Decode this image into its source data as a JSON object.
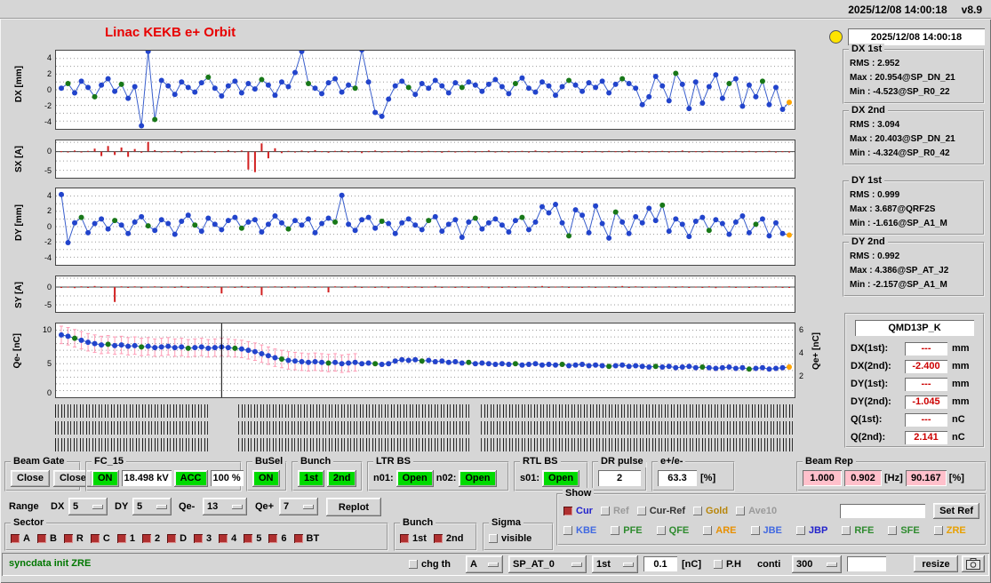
{
  "titlebar": {
    "datetime": "2025/12/08 14:00:18",
    "version": "v8.9"
  },
  "title": "Linac KEKB e+ Orbit",
  "colors": {
    "title": "#e80000",
    "green": "#00db00",
    "pink": "#ffc0cb",
    "value_red": "#cc0000",
    "message_green": "#007700",
    "lamp": "#ffe400"
  },
  "status": {
    "timestamp": "2025/12/08 14:00:18",
    "groups": [
      {
        "label": "DX 1st",
        "lines": [
          "RMS : 2.952",
          "Max : 20.954@SP_DN_21",
          "Min : -4.523@SP_R0_22"
        ]
      },
      {
        "label": "DX 2nd",
        "lines": [
          "RMS : 3.094",
          "Max : 20.403@SP_DN_21",
          "Min : -4.324@SP_R0_42"
        ]
      },
      {
        "label": "DY 1st",
        "lines": [
          "RMS : 0.999",
          "Max : 3.687@QRF2S",
          "Min : -1.616@SP_A1_M"
        ]
      },
      {
        "label": "DY 2nd",
        "lines": [
          "RMS : 0.992",
          "Max : 4.386@SP_AT_J2",
          "Min : -2.157@SP_A1_M"
        ]
      }
    ],
    "monitor": {
      "name": "QMD13P_K",
      "rows": [
        {
          "label": "DX(1st):",
          "value": "---",
          "unit": "mm"
        },
        {
          "label": "DX(2nd):",
          "value": "-2.400",
          "unit": "mm"
        },
        {
          "label": "DY(1st):",
          "value": "---",
          "unit": "mm"
        },
        {
          "label": "DY(2nd):",
          "value": "-1.045",
          "unit": "mm"
        },
        {
          "label": "Q(1st):",
          "value": "---",
          "unit": "nC"
        },
        {
          "label": "Q(2nd):",
          "value": "2.141",
          "unit": "nC"
        }
      ]
    }
  },
  "chart_data": [
    {
      "id": "dx",
      "type": "line",
      "ylabel": "DX [mm]",
      "ylim": [
        -5,
        5
      ],
      "yticks": [
        4,
        2,
        0,
        -2,
        -4
      ],
      "grid": [
        -4,
        -3,
        -2,
        -1,
        0,
        1,
        2,
        3,
        4
      ],
      "line_color": "#3a5fcd",
      "point_color": "#2244cc",
      "alt_color": "#187818",
      "last_color": "#ffa500",
      "green_indices": [
        1,
        5,
        9,
        14,
        22,
        30,
        37,
        44,
        52,
        60,
        68,
        76,
        84,
        92,
        100,
        105
      ],
      "values": [
        0.2,
        0.8,
        -0.4,
        1.1,
        0.3,
        -0.9,
        0.6,
        1.4,
        -0.2,
        0.7,
        -1.1,
        0.4,
        -4.6,
        4.9,
        -3.8,
        1.2,
        0.5,
        -0.6,
        1.0,
        0.3,
        -0.3,
        0.9,
        1.6,
        0.2,
        -0.8,
        0.5,
        1.1,
        -0.4,
        0.8,
        0.1,
        1.3,
        0.6,
        -0.7,
        1.0,
        0.4,
        2.2,
        4.9,
        0.8,
        0.2,
        -0.5,
        0.9,
        1.4,
        -0.3,
        0.6,
        0.2,
        5.1,
        1.0,
        -2.9,
        -3.4,
        -1.2,
        0.5,
        1.1,
        0.3,
        -0.6,
        0.8,
        0.2,
        1.2,
        0.5,
        -0.4,
        0.9,
        0.3,
        1.0,
        0.6,
        -0.2,
        0.7,
        1.3,
        0.4,
        -0.5,
        0.8,
        1.5,
        0.2,
        -0.3,
        1.0,
        0.5,
        -0.7,
        0.4,
        1.2,
        0.6,
        -0.2,
        0.9,
        0.3,
        1.1,
        -0.4,
        0.7,
        1.4,
        0.8,
        0.2,
        -1.9,
        -0.9,
        1.7,
        0.5,
        -1.4,
        2.1,
        0.7,
        -2.4,
        1.0,
        -1.7,
        0.4,
        1.9,
        -1.1,
        0.8,
        1.4,
        -2.1,
        0.6,
        -0.9,
        1.1,
        -1.9,
        0.3,
        -2.5,
        -1.6
      ]
    },
    {
      "id": "sx",
      "type": "bar",
      "ylabel": "SX [A]",
      "ylim": [
        -7,
        3
      ],
      "yticks": [
        0,
        -5
      ],
      "grid": [
        -5,
        -2.5,
        0,
        2.5
      ],
      "color": "#d22020",
      "values": [
        0.1,
        -0.2,
        0.3,
        -0.1,
        0.2,
        0.8,
        -1.2,
        1.5,
        -0.9,
        1.1,
        -1.4,
        0.7,
        -0.3,
        2.6,
        0.4,
        -0.2,
        0.1,
        0.3,
        -0.4,
        0.2,
        -0.1,
        0.3,
        0.2,
        -0.3,
        0.1,
        0.4,
        -0.2,
        0.3,
        -4.8,
        -5.5,
        2.2,
        -1.8,
        0.9,
        -0.4,
        0.2,
        -0.1,
        0.3,
        -0.2,
        0.4,
        0.1,
        -0.3,
        0.2,
        0.3,
        -0.1,
        0.2,
        -0.4,
        0.1,
        0.3,
        -0.2,
        0.1,
        0.2,
        -0.1,
        0.3,
        0.1,
        -0.2,
        0.2,
        0.1,
        -0.3,
        0.2,
        -0.1,
        0.1,
        0.2,
        -0.2,
        0.1,
        0.3,
        -0.1,
        0.2,
        -0.2,
        0.1,
        0.2,
        -0.1,
        0.3,
        0.1,
        -0.2,
        0.2,
        -0.1,
        0.1,
        0.2,
        -0.3,
        0.1,
        0.2,
        -0.1,
        0.2,
        0.1,
        -0.2,
        0.3,
        -0.1,
        0.2,
        -0.2,
        0.1,
        0.2,
        -0.1,
        0.1,
        0.3,
        -0.2,
        0.1,
        -0.1,
        0.2,
        0.1,
        -0.2,
        0.1,
        0.2,
        -0.1,
        0.2,
        -0.2,
        0.1,
        0.2,
        -0.1,
        0.1,
        -0.2
      ]
    },
    {
      "id": "dy",
      "type": "line",
      "ylabel": "DY [mm]",
      "ylim": [
        -5,
        5
      ],
      "yticks": [
        4,
        2,
        0,
        -2,
        -4
      ],
      "grid": [
        -4,
        -3,
        -2,
        -1,
        0,
        1,
        2,
        3,
        4
      ],
      "line_color": "#3a5fcd",
      "point_color": "#2244cc",
      "alt_color": "#187818",
      "last_color": "#ffa500",
      "green_indices": [
        3,
        8,
        13,
        20,
        27,
        34,
        41,
        48,
        55,
        62,
        69,
        76,
        83,
        90,
        97,
        104
      ],
      "values": [
        4.2,
        -2.1,
        0.5,
        1.2,
        -0.8,
        0.4,
        1.0,
        -0.3,
        0.8,
        0.2,
        -0.9,
        0.6,
        1.3,
        0.1,
        -0.5,
        0.9,
        0.4,
        -1.0,
        0.7,
        1.5,
        0.2,
        -0.6,
        1.1,
        0.3,
        -0.4,
        0.8,
        1.2,
        -0.2,
        0.6,
        0.9,
        -0.7,
        0.3,
        1.4,
        0.5,
        -0.3,
        0.8,
        0.2,
        1.0,
        -0.8,
        0.4,
        1.1,
        0.6,
        4.1,
        0.3,
        -0.5,
        0.9,
        1.2,
        -0.2,
        0.7,
        0.4,
        -0.9,
        0.5,
        1.0,
        0.2,
        -0.4,
        0.8,
        1.3,
        -0.6,
        0.3,
        0.9,
        -1.4,
        0.6,
        1.1,
        -0.3,
        0.5,
        1.0,
        0.2,
        -0.7,
        0.8,
        1.2,
        -0.4,
        0.6,
        2.6,
        1.8,
        2.9,
        0.5,
        -1.2,
        2.2,
        1.5,
        -0.8,
        2.7,
        0.4,
        -1.5,
        1.9,
        0.6,
        -0.9,
        1.3,
        0.5,
        2.4,
        0.8,
        2.8,
        -0.6,
        1.0,
        0.3,
        -1.3,
        0.7,
        1.2,
        -0.5,
        0.9,
        0.4,
        -1.0,
        0.6,
        1.4,
        -0.8,
        0.3,
        1.0,
        -1.2,
        0.5,
        -0.9,
        -1.1
      ]
    },
    {
      "id": "sy",
      "type": "bar",
      "ylabel": "SY [A]",
      "ylim": [
        -7,
        3
      ],
      "yticks": [
        0,
        -5
      ],
      "grid": [
        -5,
        -2.5,
        0,
        2.5
      ],
      "color": "#d22020",
      "values": [
        -0.2,
        0.1,
        -0.3,
        0.2,
        -0.1,
        0.3,
        -0.2,
        0.1,
        -4.2,
        0.2,
        -0.1,
        0.2,
        -0.3,
        0.1,
        0.2,
        -0.2,
        0.1,
        -0.1,
        0.3,
        -0.2,
        0.1,
        0.2,
        -0.1,
        0.2,
        -1.8,
        0.1,
        -0.2,
        0.3,
        -0.1,
        0.2,
        -2.3,
        0.1,
        0.2,
        -0.1,
        0.2,
        -0.3,
        0.1,
        0.2,
        -0.2,
        0.1,
        -1.5,
        0.2,
        -0.1,
        0.1,
        0.3,
        -0.2,
        0.1,
        -0.1,
        0.2,
        -0.3,
        0.1,
        0.2,
        -0.1,
        0.2,
        -0.2,
        0.1,
        0.3,
        -0.1,
        0.1,
        -0.2,
        0.2,
        -0.1,
        0.1,
        0.2,
        -0.3,
        0.1,
        -0.1,
        0.2,
        -0.2,
        0.1,
        0.2,
        -0.1,
        0.3,
        -0.2,
        0.1,
        0.2,
        -0.1,
        0.1,
        -0.2,
        0.2,
        -0.1,
        0.1,
        0.2,
        -0.2,
        0.3,
        -0.1,
        0.2,
        -0.1,
        0.1,
        -0.2,
        0.1,
        0.2,
        -0.1,
        0.2,
        -0.2,
        0.1,
        -0.1,
        0.2,
        -0.3,
        0.1,
        0.2,
        -0.1,
        0.1,
        -0.2,
        0.2,
        -0.1,
        0.1,
        0.2,
        -0.1,
        -0.2
      ]
    },
    {
      "id": "q",
      "type": "line",
      "ylabel": "Qe- [nC]",
      "ylabel_right": "Qe+ [nC]",
      "ylim": [
        0,
        11
      ],
      "yticks": [
        10,
        5,
        0
      ],
      "yticks_right": [
        6,
        4,
        2
      ],
      "grid": [
        1,
        2,
        3,
        4,
        5,
        6,
        7,
        8,
        9,
        10
      ],
      "line_color": "#3a5fcd",
      "point_color": "#2244cc",
      "alt_color": "#187818",
      "last_color": "#ffa500",
      "green_indices": [
        2,
        7,
        12,
        19,
        26,
        33,
        40,
        47,
        54,
        61,
        68,
        75,
        82,
        89,
        96,
        103
      ],
      "sigma": {
        "split": 45,
        "early": 1.3,
        "late": 0.3
      },
      "sigma_color": "#ff9bb5",
      "cursor_index": 24,
      "values": [
        9.3,
        9.1,
        8.8,
        8.5,
        8.2,
        8.0,
        7.8,
        7.9,
        7.7,
        7.8,
        7.6,
        7.7,
        7.5,
        7.6,
        7.4,
        7.5,
        7.6,
        7.4,
        7.5,
        7.3,
        7.4,
        7.5,
        7.3,
        7.4,
        7.5,
        7.4,
        7.3,
        7.2,
        7.0,
        6.8,
        6.5,
        6.2,
        5.9,
        5.7,
        5.5,
        5.4,
        5.3,
        5.2,
        5.3,
        5.2,
        5.1,
        5.2,
        5.0,
        5.1,
        5.2,
        5.0,
        5.1,
        5.0,
        4.9,
        5.0,
        5.4,
        5.6,
        5.5,
        5.6,
        5.4,
        5.5,
        5.3,
        5.4,
        5.2,
        5.3,
        5.1,
        5.2,
        5.0,
        5.1,
        5.0,
        4.9,
        5.0,
        4.9,
        5.0,
        4.8,
        4.9,
        5.0,
        4.8,
        4.9,
        4.8,
        4.9,
        4.7,
        4.8,
        4.9,
        4.7,
        4.8,
        4.7,
        4.6,
        4.7,
        4.8,
        4.6,
        4.7,
        4.6,
        4.5,
        4.6,
        4.5,
        4.6,
        4.4,
        4.5,
        4.6,
        4.4,
        4.5,
        4.4,
        4.3,
        4.4,
        4.5,
        4.3,
        4.4,
        4.2,
        4.3,
        4.4,
        4.2,
        4.3,
        4.4,
        4.5
      ]
    }
  ],
  "row1": {
    "beam_gate": {
      "label": "Beam Gate",
      "buttons": [
        "Close",
        "Close"
      ]
    },
    "fc15": {
      "label": "FC_15",
      "on": "ON",
      "kv": "18.498 kV",
      "acc": "ACC",
      "pct": "100 %"
    },
    "busel": {
      "label": "BuSel",
      "on": "ON"
    },
    "bunch": {
      "label": "Bunch",
      "b1": "1st",
      "b2": "2nd"
    },
    "ltr_bs": {
      "label": "LTR BS",
      "n01_label": "n01:",
      "n01_value": "Open",
      "n02_label": "n02:",
      "n02_value": "Open"
    },
    "rtl_bs": {
      "label": "RTL BS",
      "s01_label": "s01:",
      "s01_value": "Open"
    },
    "dr_pulse": {
      "label": "DR pulse",
      "value": "2"
    },
    "ratio": {
      "label": "e+/e-",
      "value": "63.3",
      "unit": "[%]"
    },
    "beam_rep": {
      "label": "Beam Rep",
      "values": [
        "1.000",
        "0.902",
        "90.167"
      ],
      "units": [
        "[Hz]",
        "[%]"
      ]
    }
  },
  "row2": {
    "range_label": "Range",
    "dx_label": "DX",
    "dx_value": "5",
    "dy_label": "DY",
    "dy_value": "5",
    "qem_label": "Qe-",
    "qem_value": "13",
    "qep_label": "Qe+",
    "qep_value": "7",
    "replot_label": "Replot"
  },
  "show": {
    "label": "Show",
    "row1": [
      {
        "label": "Cur",
        "color": "#2222cc",
        "checked": true
      },
      {
        "label": "Ref",
        "color": "#9a9a9a",
        "checked": false
      },
      {
        "label": "Cur-Ref",
        "color": "#333333",
        "checked": false
      },
      {
        "label": "Gold",
        "color": "#b8860b",
        "checked": false
      },
      {
        "label": "Ave10",
        "color": "#9a9a9a",
        "checked": false
      }
    ],
    "ref_entry": "",
    "set_ref_label": "Set Ref",
    "row2": [
      {
        "label": "KBE",
        "color": "#4169e1",
        "checked": false
      },
      {
        "label": "PFE",
        "color": "#2e8b2e",
        "checked": false
      },
      {
        "label": "QFE",
        "color": "#2e8b2e",
        "checked": false
      },
      {
        "label": "ARE",
        "color": "#e89000",
        "checked": false
      },
      {
        "label": "JBE",
        "color": "#4169e1",
        "checked": false
      },
      {
        "label": "JBP",
        "color": "#2222cc",
        "checked": false
      },
      {
        "label": "RFE",
        "color": "#2e8b2e",
        "checked": false
      },
      {
        "label": "SFE",
        "color": "#2e8b2e",
        "checked": false
      },
      {
        "label": "ZRE",
        "color": "#e8a000",
        "checked": false
      }
    ]
  },
  "sector": {
    "label": "Sector",
    "items": [
      {
        "label": "A",
        "checked": true
      },
      {
        "label": "B",
        "checked": true
      },
      {
        "label": "R",
        "checked": true
      },
      {
        "label": "C",
        "checked": true
      },
      {
        "label": "1",
        "checked": true
      },
      {
        "label": "2",
        "checked": true
      },
      {
        "label": "D",
        "checked": true
      },
      {
        "label": "3",
        "checked": true
      },
      {
        "label": "4",
        "checked": true
      },
      {
        "label": "5",
        "checked": true
      },
      {
        "label": "6",
        "checked": true
      },
      {
        "label": "BT",
        "checked": true
      }
    ]
  },
  "bunch2": {
    "label": "Bunch",
    "items": [
      {
        "label": "1st",
        "checked": true
      },
      {
        "label": "2nd",
        "checked": true
      }
    ]
  },
  "sigma": {
    "label": "Sigma",
    "item": {
      "label": "visible",
      "checked": false
    }
  },
  "statusbar": {
    "message": "syncdata init ZRE",
    "chg_th": {
      "label": "chg th",
      "checked": false
    },
    "select_a": "A",
    "select_sp": "SP_AT_0",
    "select_bunch": "1st",
    "threshold": "0.1",
    "unit": "[nC]",
    "ph": {
      "label": "P.H",
      "checked": false
    },
    "conti_label": "conti",
    "select_n": "300",
    "extra_entry": "",
    "resize_label": "resize"
  }
}
